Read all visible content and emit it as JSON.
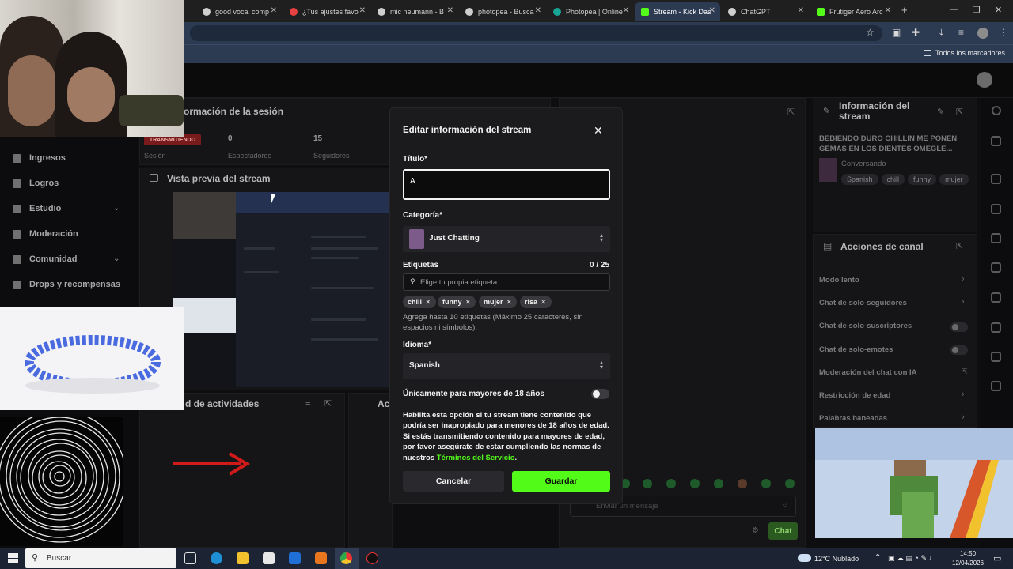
{
  "browser": {
    "tabs": [
      {
        "label": "good vocal comp",
        "color": "#cfcfcf"
      },
      {
        "label": "¿Tus ajustes favo",
        "color": "#e84141"
      },
      {
        "label": "mic neumann - B",
        "color": "#cfcfcf"
      },
      {
        "label": "photopea - Busca",
        "color": "#cfcfcf"
      },
      {
        "label": "Photopea | Online",
        "color": "#18a497"
      },
      {
        "label": "Stream - Kick Das",
        "color": "#53fc18"
      },
      {
        "label": "ChatGPT",
        "color": "#cfcfcf"
      },
      {
        "label": "Frutiger Aero Arc",
        "color": "#53fc18"
      }
    ],
    "new_tab": "+",
    "bookmarks_label": "Todos los marcadores"
  },
  "sidebar": {
    "items": [
      {
        "label": "Ingresos",
        "chevron": false
      },
      {
        "label": "Logros",
        "chevron": false
      },
      {
        "label": "Estudio",
        "chevron": true
      },
      {
        "label": "Moderación",
        "chevron": false
      },
      {
        "label": "Comunidad",
        "chevron": true
      },
      {
        "label": "Drops y recompensas",
        "chevron": false
      }
    ]
  },
  "session": {
    "title": "formación de la sesión",
    "live_badge": "TRANSMITIENDO",
    "stats": [
      {
        "value": "0",
        "label": "Espectadores"
      },
      {
        "value": "15",
        "label": "Seguidores"
      }
    ],
    "sesion_label": "Sesión"
  },
  "preview": {
    "title": "Vista previa del stream"
  },
  "activity": {
    "title": "d de actividades",
    "ac_title": "Ac"
  },
  "stream_info": {
    "title": "Información del stream",
    "stream_title": "BEBIENDO DURO CHILLIN ME PONEN GEMAS EN LOS DIENTES OMEGLE...",
    "category": "Conversando",
    "tags": [
      "Spanish",
      "chill",
      "funny",
      "mujer"
    ]
  },
  "channel_actions": {
    "title": "Acciones de canal",
    "items": [
      {
        "label": "Modo lento",
        "type": "chevron"
      },
      {
        "label": "Chat de solo-seguidores",
        "type": "chevron"
      },
      {
        "label": "Chat de solo-suscriptores",
        "type": "toggle"
      },
      {
        "label": "Chat de solo-emotes",
        "type": "toggle"
      },
      {
        "label": "Moderación del chat con IA",
        "type": "external"
      },
      {
        "label": "Restricción de edad",
        "type": "chevron"
      },
      {
        "label": "Palabras baneadas",
        "type": "chevron"
      }
    ]
  },
  "chat": {
    "placeholder": "Enviar un mensaje",
    "send_label": "Chat"
  },
  "modal": {
    "title": "Editar información del stream",
    "title_label": "Título*",
    "title_value": "A",
    "category_label": "Categoría*",
    "category_value": "Just Chatting",
    "tags_label": "Etiquetas",
    "tags_count": "0 / 25",
    "tags_placeholder": "Elige tu propia etiqueta",
    "tags": [
      "chill",
      "funny",
      "mujer",
      "risa"
    ],
    "tags_help": "Agrega hasta 10 etiquetas (Máximo 25 caracteres, sin espacios ni símbolos).",
    "language_label": "Idioma*",
    "language_value": "Spanish",
    "adult_label": "Únicamente para mayores de 18 años",
    "adult_enabled": false,
    "adult_desc": "Habilita esta opción si tu stream tiene contenido que podría ser inapropiado para menores de 18 años de edad. Si estás transmitiendo contenido para mayores de edad, por favor asegúrate de estar cumpliendo las normas de nuestros ",
    "adult_link": "Términos del Servicio",
    "adult_end": ".",
    "cancel": "Cancelar",
    "save": "Guardar"
  },
  "taskbar": {
    "search_placeholder": "Buscar",
    "weather": "12°C  Nublado",
    "time": "14:50",
    "date": "12/04/2026"
  }
}
